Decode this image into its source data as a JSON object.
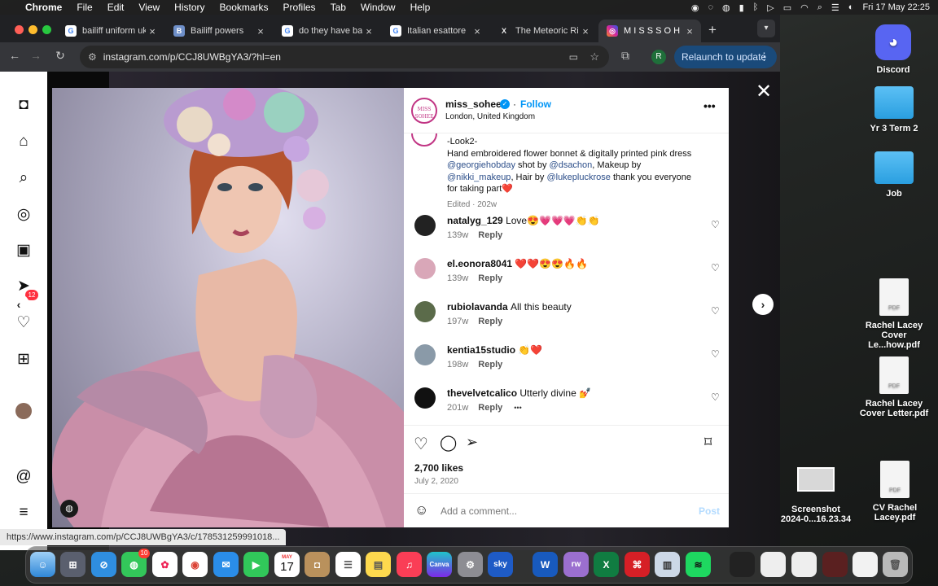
{
  "menubar": {
    "items": [
      "Chrome",
      "File",
      "Edit",
      "View",
      "History",
      "Bookmarks",
      "Profiles",
      "Tab",
      "Window",
      "Help"
    ],
    "clock": "Fri 17 May  22:25"
  },
  "tabs": [
    {
      "title": "bailiff uniform uk",
      "fav": "G",
      "color": "#ffffff"
    },
    {
      "title": "Bailiff powers",
      "fav": "B",
      "color": "#6e8fc9"
    },
    {
      "title": "do they have bail",
      "fav": "G",
      "color": "#ffffff"
    },
    {
      "title": "Italian esattore",
      "fav": "G",
      "color": "#ffffff"
    },
    {
      "title": "The Meteoric Rise",
      "fav": "X",
      "color": "#222222"
    },
    {
      "title": "M I S S S O H E E",
      "fav": "◎",
      "color": "#d6249f"
    }
  ],
  "toolbar": {
    "url": "instagram.com/p/CCJ8UWBgYA3/?hl=en",
    "relaunch": "Relaunch to update",
    "profile": "R"
  },
  "sidebar": {
    "badge": "12",
    "icons": [
      "instagram-icon",
      "home-icon",
      "search-icon",
      "explore-icon",
      "reels-icon",
      "messages-icon",
      "notifications-icon",
      "create-icon",
      "profile-icon",
      "threads-icon",
      "menu-icon"
    ]
  },
  "post": {
    "avatar_text": "MISS SOHEE",
    "username": "miss_sohee",
    "follow": "Follow",
    "location": "London, United Kingdom",
    "caption_line1": "-Look2-",
    "caption_line2": "Hand embroidered flower bonnet & digitally printed pink dress",
    "mention1": "@georgiehobday",
    "shot_by": " shot by ",
    "mention2": "@dsachon",
    "makeup_by": ", Makeup by",
    "mention3": "@nikki_makeup",
    "hair_by": ", Hair by ",
    "mention4": "@lukepluckrose",
    "thanks": " thank you everyone",
    "caption_end": "for taking part❤️",
    "edited": "Edited · 202w",
    "comments": [
      {
        "user": "natalyg_129",
        "text": "Love😍💗💗💗👏👏",
        "age": "139w",
        "reply": "Reply",
        "avatar_color": "#222222"
      },
      {
        "user": "el.eonora8041",
        "text": "❤️❤️😍😍🔥🔥",
        "age": "139w",
        "reply": "Reply",
        "avatar_color": "#d9a7b8"
      },
      {
        "user": "rubiolavanda",
        "text": "All this beauty",
        "age": "197w",
        "reply": "Reply",
        "avatar_color": "#5b6b4a"
      },
      {
        "user": "kentia15studio",
        "text": "👏❤️",
        "age": "198w",
        "reply": "Reply",
        "avatar_color": "#8a9aa8"
      },
      {
        "user": "thevelvetcalico",
        "text": "Utterly divine 💅",
        "age": "201w",
        "reply": "Reply",
        "avatar_color": "#111111"
      }
    ],
    "more": "•••",
    "likes": "2,700 likes",
    "date": "July 2, 2020",
    "comment_placeholder": "Add a comment...",
    "post_btn": "Post"
  },
  "status_url": "https://www.instagram.com/p/CCJ8UWBgYA3/c/178531259991018...",
  "desktop": [
    {
      "label": "Discord"
    },
    {
      "label": "Yr 3 Term 2"
    },
    {
      "label": "Job"
    },
    {
      "label": "Rachel Lacey Cover Le...how.pdf"
    },
    {
      "label": "Rachel Lacey Cover Letter.pdf"
    },
    {
      "label": "Screenshot 2024-0...16.23.34"
    },
    {
      "label": "CV Rachel Lacey.pdf"
    }
  ],
  "dock": {
    "messages_badge": "10",
    "calendar_month": "MAY",
    "calendar_day": "17",
    "apps": [
      "Finder",
      "Launchpad",
      "Safari",
      "Messages",
      "Photos",
      "Chrome",
      "Mail",
      "FaceTime",
      "Calendar",
      "Contacts",
      "Reminders",
      "Notes",
      "Music",
      "Canva",
      "System Settings",
      "Sky Go",
      "Word",
      "RealVNC",
      "Excel",
      "Acrobat",
      "Preview",
      "Spotify"
    ]
  }
}
